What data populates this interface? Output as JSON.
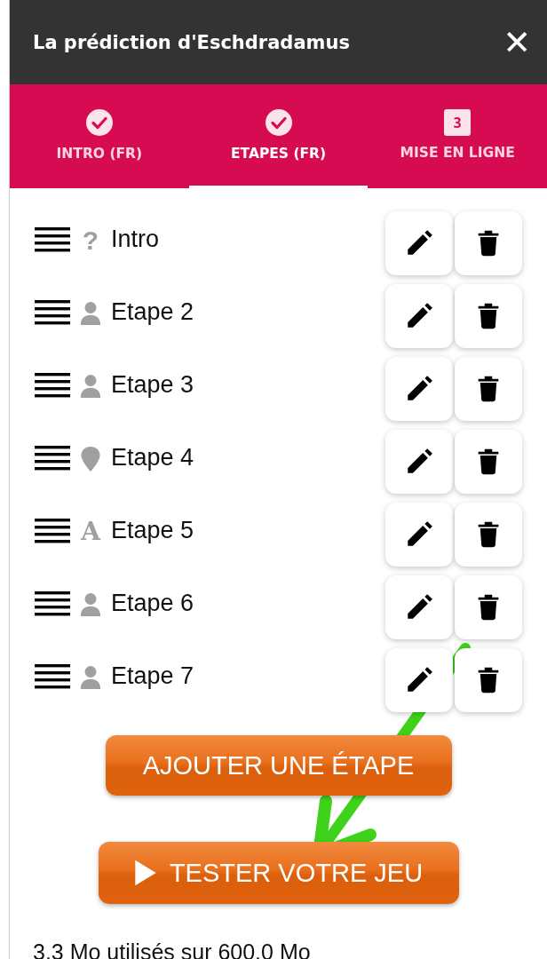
{
  "header": {
    "title": "La prédiction d'Eschdradamus",
    "close": "✕"
  },
  "tabs": [
    {
      "label": "INTRO (FR)",
      "kind": "done",
      "selected": false
    },
    {
      "label": "ETAPES (FR)",
      "kind": "done",
      "selected": true
    },
    {
      "label": "MISE EN LIGNE",
      "kind": "number",
      "number": "3",
      "selected": false
    }
  ],
  "steps": [
    {
      "label": "Intro",
      "kind": "question",
      "icon": "?"
    },
    {
      "label": "Etape 2",
      "kind": "person"
    },
    {
      "label": "Etape 3",
      "kind": "person"
    },
    {
      "label": "Etape 4",
      "kind": "pin"
    },
    {
      "label": "Etape 5",
      "kind": "text",
      "icon": "A"
    },
    {
      "label": "Etape 6",
      "kind": "person"
    },
    {
      "label": "Etape 7",
      "kind": "person"
    }
  ],
  "add_button": "AJOUTER UNE ÉTAPE",
  "test_button": "TESTER VOTRE JEU",
  "storage": "3.3 Mo utilisés sur 600.0 Mo"
}
